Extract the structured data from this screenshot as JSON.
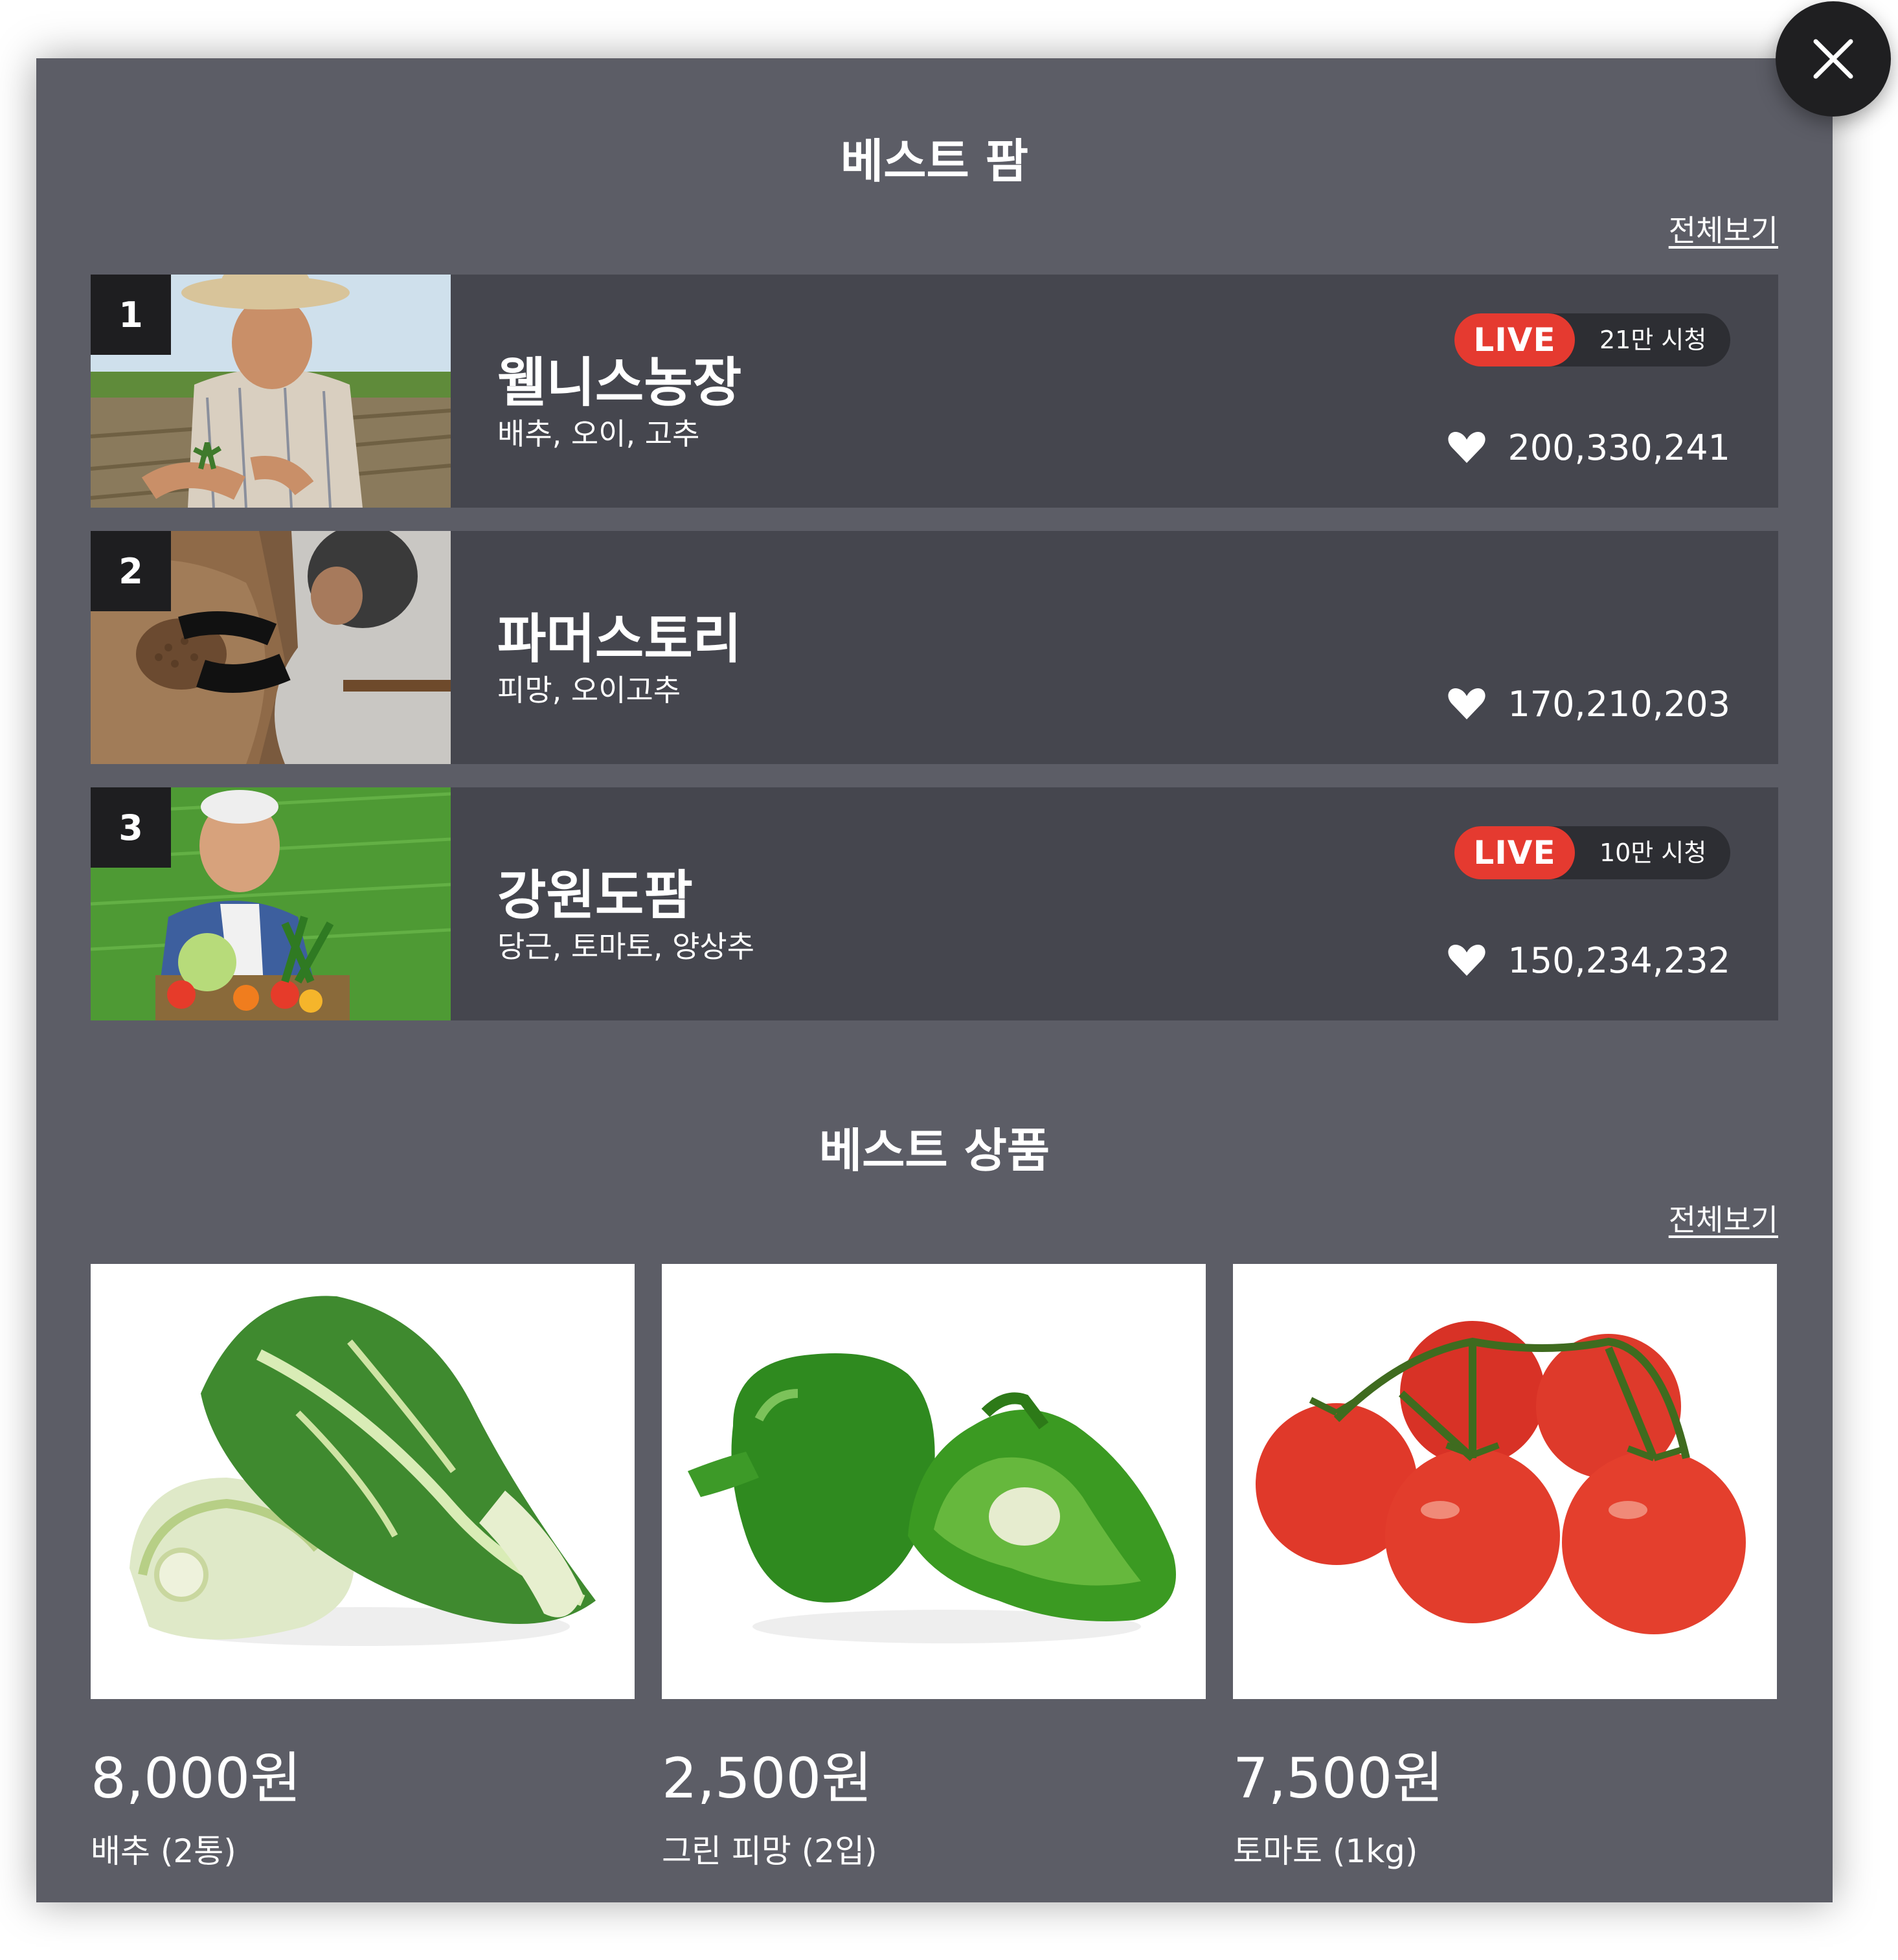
{
  "close_icon": "x-icon",
  "best_farm": {
    "title": "베스트 팜",
    "view_all": "전체보기",
    "farms": [
      {
        "rank": "1",
        "name": "웰니스농장",
        "items": "배추, 오이, 고추",
        "live": "LIVE",
        "viewers": "21만 시청",
        "likes": "200,330,241"
      },
      {
        "rank": "2",
        "name": "파머스토리",
        "items": "피망, 오이고추",
        "likes": "170,210,203"
      },
      {
        "rank": "3",
        "name": "강원도팜",
        "items": "당근, 토마토, 양상추",
        "live": "LIVE",
        "viewers": "10만 시청",
        "likes": "150,234,232"
      }
    ]
  },
  "best_products": {
    "title": "베스트 상품",
    "view_all": "전체보기",
    "products": [
      {
        "price": "8,000원",
        "name": "배추 (2통)"
      },
      {
        "price": "2,500원",
        "name": "그린 피망 (2입)"
      },
      {
        "price": "7,500원",
        "name": "토마토 (1kg)"
      }
    ]
  },
  "colors": {
    "panel": "#5c5d66",
    "row": "#45464e",
    "live": "#e53a30",
    "close": "#1f1f21"
  }
}
